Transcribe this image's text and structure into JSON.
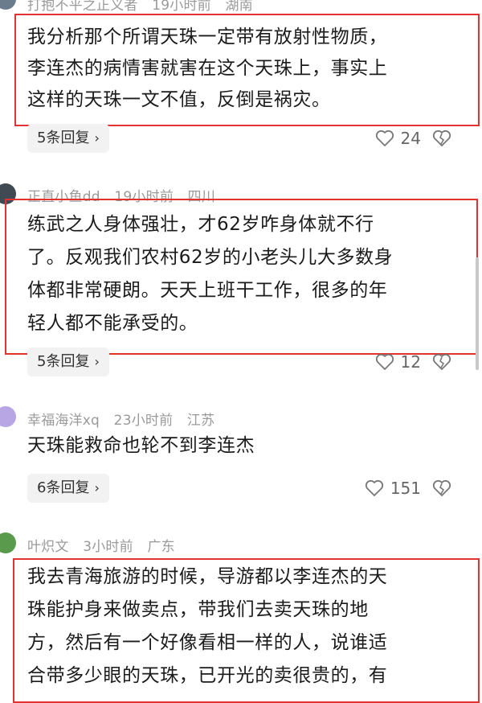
{
  "comments": [
    {
      "author": "打抱不平之正义者",
      "time": "19小时前",
      "location": "湖南",
      "lines": [
        "我分析那个所谓天珠一定带有放射性物质，",
        "李连杰的病情害就害在这个天珠上，事实上",
        "这样的天珠一文不值，反倒是祸灾。"
      ],
      "replies": "5条回复",
      "likes": "24"
    },
    {
      "author": "正直小鱼dd",
      "time": "19小时前",
      "location": "四川",
      "lines": [
        "练武之人身体强壮，才62岁咋身体就不行",
        "了。反观我们农村62岁的小老头儿大多数身",
        "体都非常硬朗。天天上班干工作，很多的年",
        "轻人都不能承受的。"
      ],
      "replies": "5条回复",
      "likes": "12"
    },
    {
      "author": "幸福海洋xq",
      "time": "23小时前",
      "location": "江苏",
      "lines": [
        "天珠能救命也轮不到李连杰"
      ],
      "replies": "6条回复",
      "likes": "151"
    },
    {
      "author": "叶炽文",
      "time": "3小时前",
      "location": "广东",
      "lines": [
        "我去青海旅游的时候，导游都以李连杰的天",
        "珠能护身来做卖点，带我们去卖天珠的地",
        "方，然后有一个好像看相一样的人，说谁适",
        "合带多少眼的天珠，已开光的卖很贵的，有"
      ]
    }
  ],
  "colors": {
    "highlight": "#e23232",
    "meta": "#9a9a9a"
  },
  "icons": [
    "heart-outline-icon",
    "broken-heart-icon",
    "chevron-right-icon"
  ]
}
